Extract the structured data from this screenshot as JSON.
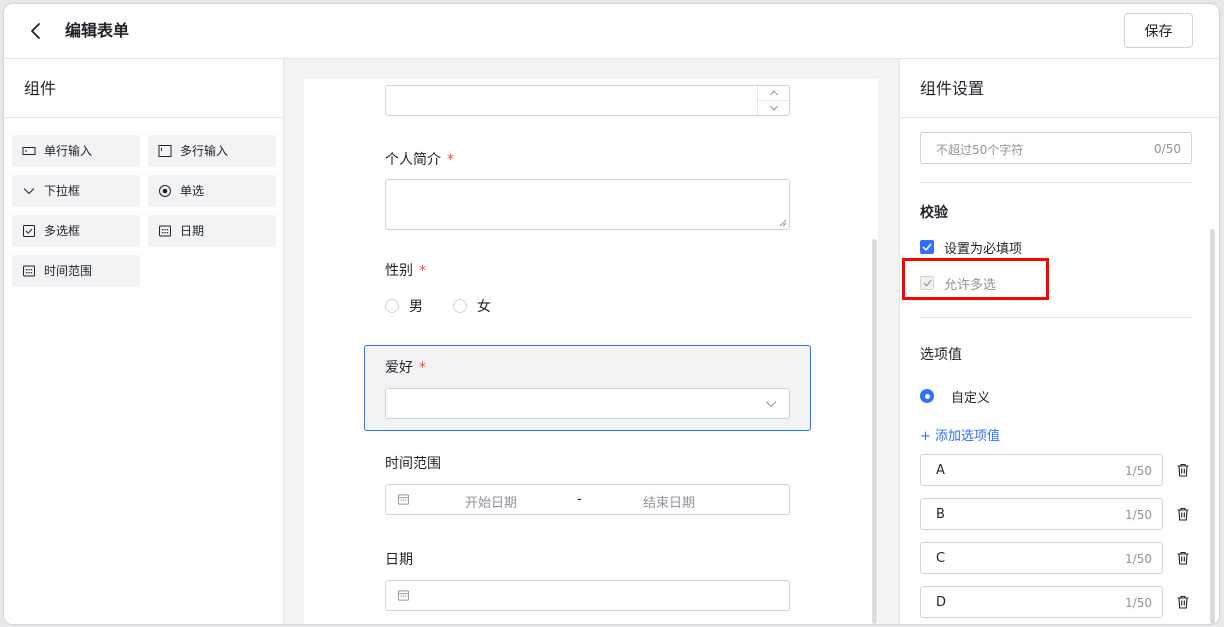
{
  "header": {
    "title": "编辑表单",
    "save_label": "保存"
  },
  "components_panel": {
    "title": "组件",
    "items": [
      {
        "label": "单行输入",
        "icon": "single-line-input-icon"
      },
      {
        "label": "多行输入",
        "icon": "multi-line-input-icon"
      },
      {
        "label": "下拉框",
        "icon": "chevron-down-icon"
      },
      {
        "label": "单选",
        "icon": "radio-icon"
      },
      {
        "label": "多选框",
        "icon": "checkbox-icon"
      },
      {
        "label": "日期",
        "icon": "calendar-icon"
      },
      {
        "label": "时间范围",
        "icon": "calendar-range-icon"
      }
    ]
  },
  "form": {
    "intro": {
      "label": "个人简介",
      "required": "*"
    },
    "gender": {
      "label": "性别",
      "required": "*",
      "options": [
        "男",
        "女"
      ]
    },
    "hobby": {
      "label": "爱好",
      "required": "*"
    },
    "time_range": {
      "label": "时间范围",
      "start_placeholder": "开始日期",
      "separator": "-",
      "end_placeholder": "结束日期"
    },
    "date": {
      "label": "日期"
    }
  },
  "settings": {
    "title": "组件设置",
    "placeholder_input": {
      "placeholder": "不超过50个字符",
      "count": "0/50"
    },
    "validation": {
      "title": "校验",
      "required_label": "设置为必填项",
      "multi_label": "允许多选"
    },
    "options": {
      "title": "选项值",
      "custom_label": "自定义",
      "add_label": "添加选项值",
      "add_icon": "+",
      "items": [
        {
          "value": "A",
          "count": "1/50"
        },
        {
          "value": "B",
          "count": "1/50"
        },
        {
          "value": "C",
          "count": "1/50"
        },
        {
          "value": "D",
          "count": "1/50"
        }
      ]
    }
  },
  "colors": {
    "accent": "#3370ff",
    "required": "#f54a45",
    "highlight": "#ff0000"
  }
}
